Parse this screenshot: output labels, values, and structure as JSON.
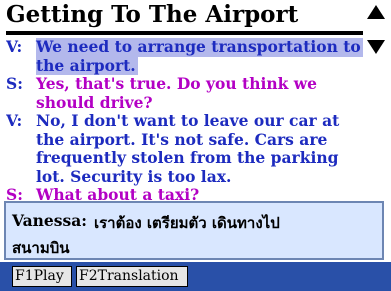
{
  "title": "Getting To The Airport",
  "dialog": [
    {
      "speaker": "V:",
      "text": "We need to arrange transportation to",
      "role": "v",
      "highlight": true
    },
    {
      "speaker": "",
      "text": "the airport.",
      "role": "v",
      "highlight": true
    },
    {
      "speaker": "S:",
      "text": "Yes, that's true. Do you think we",
      "role": "s",
      "highlight": false
    },
    {
      "speaker": "",
      "text": "should drive?",
      "role": "s",
      "highlight": false
    },
    {
      "speaker": "V:",
      "text": "No, I don't want to leave our car at",
      "role": "v",
      "highlight": false
    },
    {
      "speaker": "",
      "text": "the airport. It's not safe. Cars are",
      "role": "v",
      "highlight": false
    },
    {
      "speaker": "",
      "text": "frequently stolen from the parking",
      "role": "v",
      "highlight": false
    },
    {
      "speaker": "",
      "text": "lot. Security is too lax.",
      "role": "v",
      "highlight": false
    },
    {
      "speaker": "S:",
      "text": "What about a taxi?",
      "role": "s",
      "highlight": false
    }
  ],
  "translation": {
    "speaker": "Vanessa:",
    "line1": "เราต้อง เตรียมตัว เดินทางไป",
    "line2": "สนามบิน"
  },
  "buttons": {
    "play": "F1Play",
    "translation": "F2Translation"
  },
  "colors": {
    "speaker_v": "#1d2bbf",
    "speaker_s": "#b300c4",
    "highlight": "#b3b8ec",
    "translation_bg": "#d9e7ff",
    "bottom_bar": "#2950a8"
  }
}
